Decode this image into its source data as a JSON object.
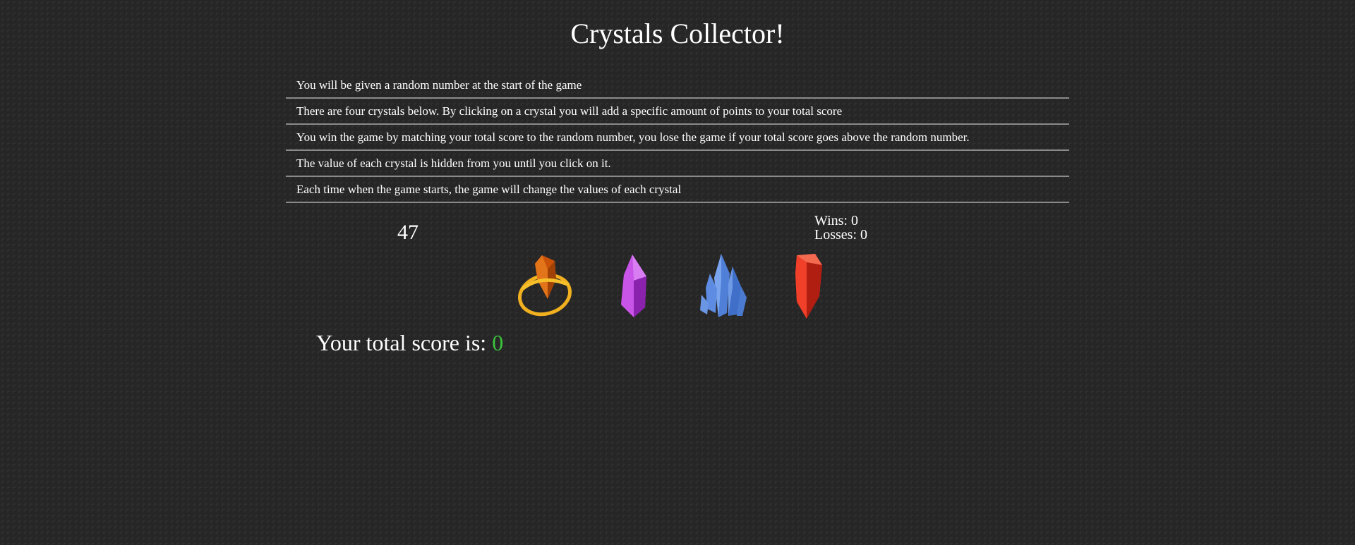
{
  "title": "Crystals Collector!",
  "rules": [
    "You will be given a random number at the start of the game",
    "There are four crystals below. By clicking on a crystal you will add a specific amount of points to your total score",
    "You win the game by matching your total score to the random number, you lose the game if your total score goes above the random number.",
    "The value of each crystal is hidden from you until you click on it.",
    "Each time when the game starts, the game will change the values of each crystal"
  ],
  "target_number": "47",
  "stats": {
    "wins_label": "Wins:",
    "wins": "0",
    "losses_label": "Losses:",
    "losses": "0"
  },
  "crystals": [
    {
      "name": "orange-ringed-crystal-icon",
      "color": "#d9620f"
    },
    {
      "name": "purple-crystal-icon",
      "color": "#b83ad6"
    },
    {
      "name": "blue-crystal-cluster-icon",
      "color": "#5b8de0"
    },
    {
      "name": "red-crystal-icon",
      "color": "#e0301e"
    }
  ],
  "score": {
    "label": "Your total score is:",
    "value": "0",
    "value_color": "#3bc43b"
  }
}
